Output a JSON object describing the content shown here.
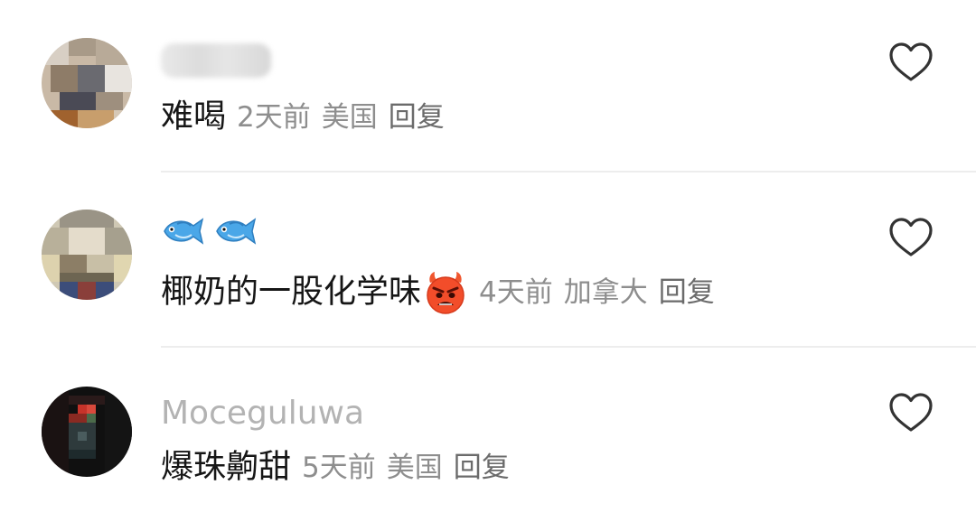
{
  "comments": [
    {
      "username": "",
      "username_blurred": true,
      "text": "难喝",
      "time": "2天前",
      "location": "美国",
      "reply_label": "回复",
      "avatar_icon": "blurred-avatar"
    },
    {
      "username_icons": [
        "fish-icon",
        "fish-icon"
      ],
      "text": "椰奶的一股化学味",
      "text_emoji": "angry-devil-icon",
      "time": "4天前",
      "location": "加拿大",
      "reply_label": "回复",
      "avatar_icon": "blurred-avatar"
    },
    {
      "username": "Moceguluwa",
      "text": "爆珠齁甜",
      "time": "5天前",
      "location": "美国",
      "reply_label": "回复",
      "avatar_icon": "blurred-avatar"
    }
  ],
  "colors": {
    "text": "#161616",
    "meta": "#8e8e8e",
    "username": "#b3b3b3",
    "divider": "#ededed",
    "heart": "#333333"
  }
}
